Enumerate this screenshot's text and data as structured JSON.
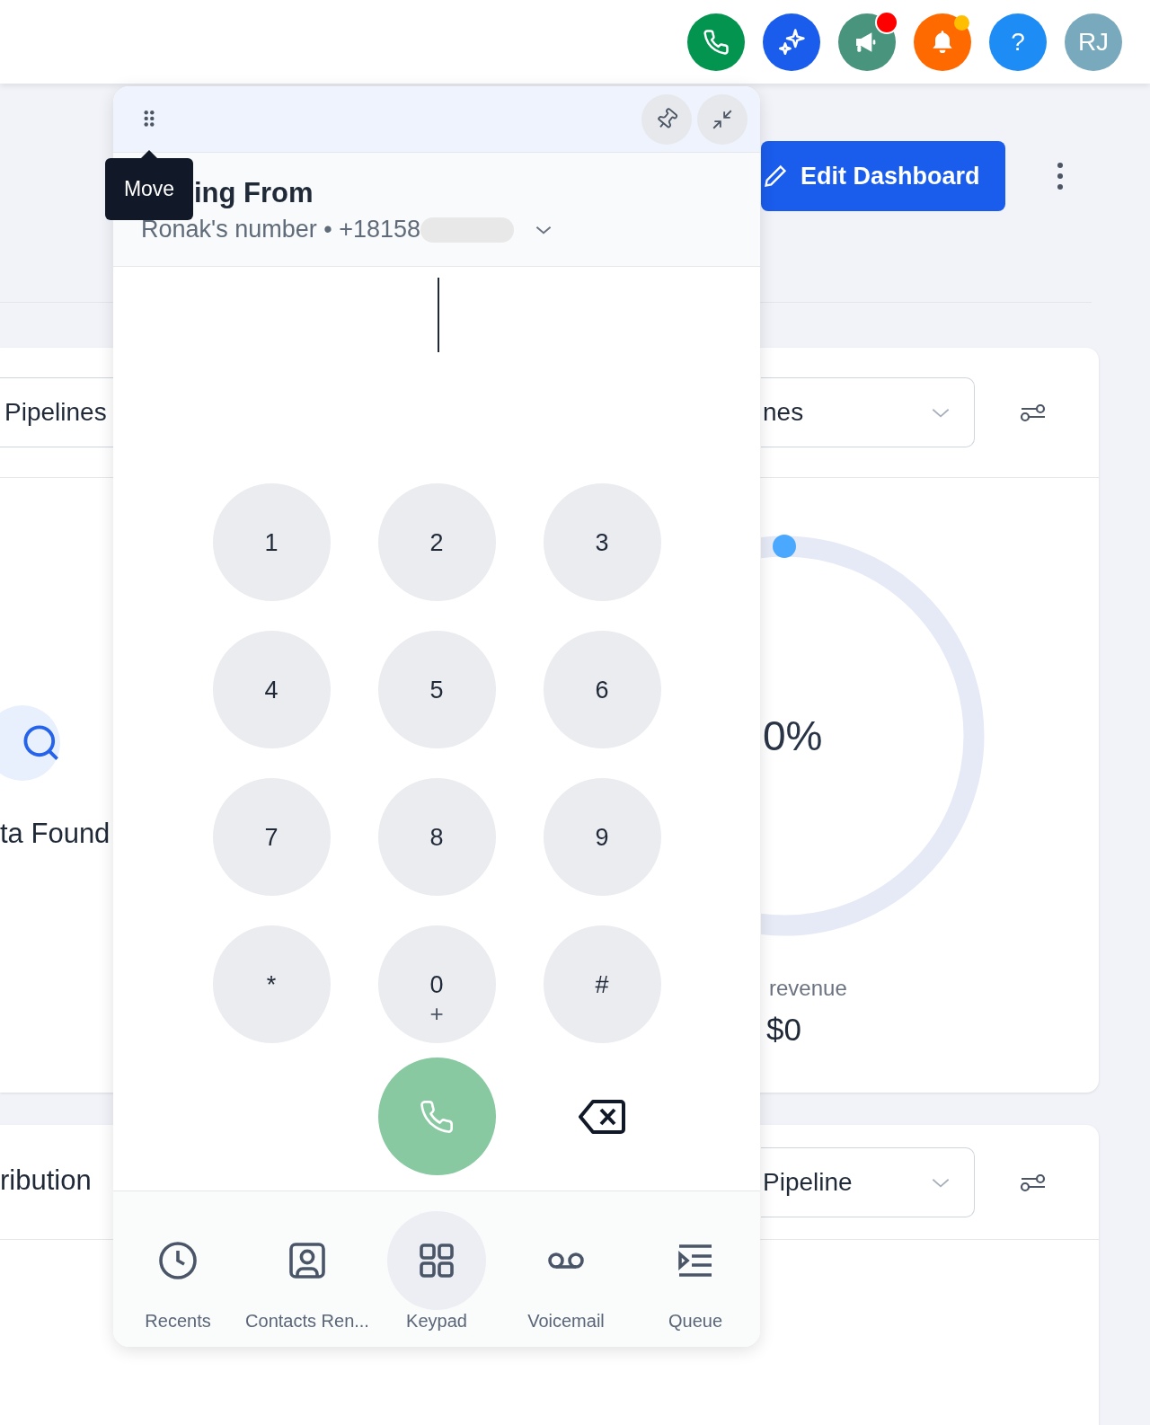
{
  "header_actions": [
    {
      "kind": "phone",
      "color": "#03954f"
    },
    {
      "kind": "sparkle",
      "color": "#1a5ceb"
    },
    {
      "kind": "megaphone",
      "color": "#48947c",
      "badge": {
        "color": "#ff0000"
      }
    },
    {
      "kind": "bell",
      "color": "#ff6a00",
      "badge": {
        "color": "#ffbf00"
      }
    },
    {
      "kind": "help",
      "color": "#1e8cf5",
      "label": "?"
    },
    {
      "kind": "avatar",
      "color": "#79a9bc",
      "label": "RJ"
    }
  ],
  "toolbar": {
    "edit_button": "Edit Dashboard"
  },
  "card_1": {
    "left_dropdown": "Pipelines",
    "empty_text": "ta Found",
    "right_dropdown": "nes",
    "progress": {
      "center_text": "0%",
      "caption": "revenue",
      "value": "$0"
    }
  },
  "card_2": {
    "title": "ribution",
    "right_dropdown": "Pipeline"
  },
  "dialer": {
    "tooltip": "Move",
    "title": "ing From",
    "caller": "Ronak's number • +18158",
    "keys": [
      {
        "digit": "1"
      },
      {
        "digit": "2"
      },
      {
        "digit": "3"
      },
      {
        "digit": "4"
      },
      {
        "digit": "5"
      },
      {
        "digit": "6"
      },
      {
        "digit": "7"
      },
      {
        "digit": "8"
      },
      {
        "digit": "9"
      },
      {
        "digit": "*"
      },
      {
        "digit": "0",
        "sub": "+"
      },
      {
        "digit": "#"
      }
    ],
    "nav": [
      {
        "kind": "clock",
        "label": "Recents",
        "selected": false
      },
      {
        "kind": "contact",
        "label": "Contacts Ren...",
        "selected": false
      },
      {
        "kind": "keypad",
        "label": "Keypad",
        "selected": true
      },
      {
        "kind": "voicemail",
        "label": "Voicemail",
        "selected": false
      },
      {
        "kind": "queue",
        "label": "Queue",
        "selected": false
      }
    ]
  }
}
